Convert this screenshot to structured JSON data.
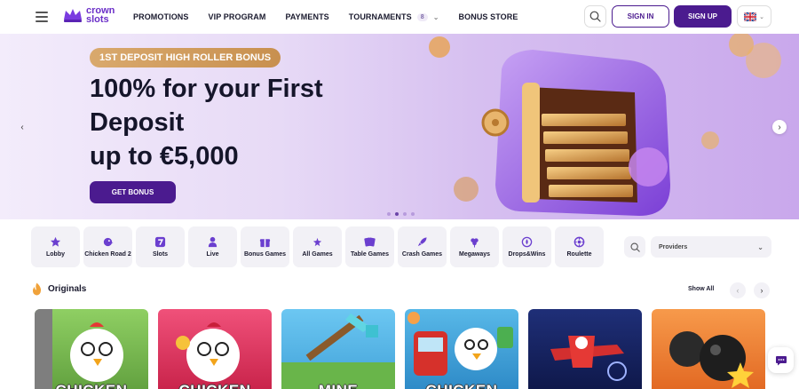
{
  "header": {
    "logo_line1": "crown",
    "logo_line2": "slots",
    "nav": [
      {
        "label": "PROMOTIONS"
      },
      {
        "label": "VIP PROGRAM"
      },
      {
        "label": "PAYMENTS"
      },
      {
        "label": "TOURNAMENTS",
        "badge": "8"
      },
      {
        "label": "BONUS STORE"
      }
    ],
    "signin_label": "SIGN IN",
    "signup_label": "SIGN UP",
    "language_icon": "uk-flag-icon",
    "accent_color": "#4b1b8f"
  },
  "hero": {
    "badge": "1ST DEPOSIT HIGH ROLLER BONUS",
    "title_lines": [
      "100% for your First",
      "Deposit",
      "up to €5,000"
    ],
    "cta_label": "GET BONUS",
    "slide_count": 4,
    "active_slide": 2
  },
  "categories": [
    {
      "label": "Lobby",
      "icon": "star-icon"
    },
    {
      "label": "Chicken Road 2",
      "icon": "chicken-icon"
    },
    {
      "label": "Slots",
      "icon": "seven-icon"
    },
    {
      "label": "Live",
      "icon": "dealer-icon"
    },
    {
      "label": "Bonus Games",
      "icon": "gift-icon"
    },
    {
      "label": "All Games",
      "icon": "stars-icon"
    },
    {
      "label": "Table Games",
      "icon": "cards-icon"
    },
    {
      "label": "Crash Games",
      "icon": "rocket-icon"
    },
    {
      "label": "Megaways",
      "icon": "clover-icon"
    },
    {
      "label": "Drops&Wins",
      "icon": "drops-icon"
    },
    {
      "label": "Roulette",
      "icon": "roulette-icon"
    }
  ],
  "providers": {
    "label": "Providers"
  },
  "originals": {
    "title": "Originals",
    "show_all": "Show All",
    "tiles": [
      {
        "name": "CHICKEN",
        "bg": "#6ab04c"
      },
      {
        "name": "CHICKEN",
        "bg": "#e8365d"
      },
      {
        "name": "MINE",
        "bg": "#4fb3ea"
      },
      {
        "name": "CHICKEN",
        "bg": "#3aa0d8"
      },
      {
        "name": "",
        "bg": "#1b2a6b"
      },
      {
        "name": "",
        "bg": "#f0853a"
      }
    ]
  }
}
